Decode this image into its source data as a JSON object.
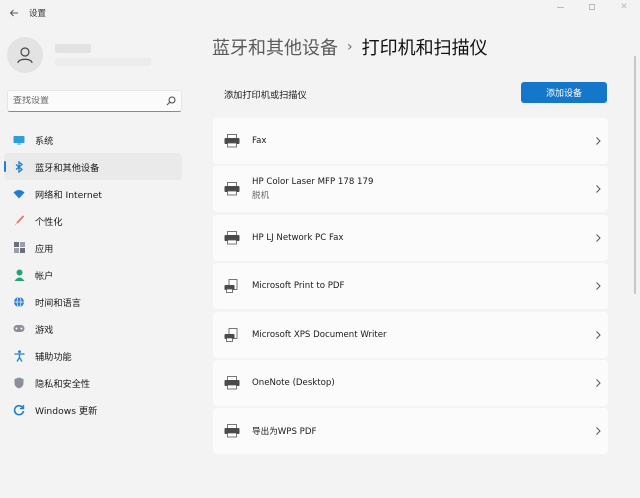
{
  "window": {
    "app_title": "设置",
    "back_icon": "back-arrow-icon"
  },
  "sidebar": {
    "search_placeholder": "查找设置",
    "items": [
      {
        "label": "系统",
        "icon": "monitor-icon",
        "color": "#2b9fd8",
        "active": false
      },
      {
        "label": "蓝牙和其他设备",
        "icon": "bluetooth-icon",
        "color": "#1f7fd0",
        "active": true
      },
      {
        "label": "网络和 Internet",
        "icon": "wifi-icon",
        "color": "#1f7fd0",
        "active": false
      },
      {
        "label": "个性化",
        "icon": "brush-icon",
        "color": "#d9826b",
        "active": false
      },
      {
        "label": "应用",
        "icon": "apps-icon",
        "color": "#6b6f78",
        "active": false
      },
      {
        "label": "帐户",
        "icon": "account-icon",
        "color": "#1fa37a",
        "active": false
      },
      {
        "label": "时间和语言",
        "icon": "globe-clock-icon",
        "color": "#2b7fd0",
        "active": false
      },
      {
        "label": "游戏",
        "icon": "gamepad-icon",
        "color": "#8b8f98",
        "active": false
      },
      {
        "label": "辅助功能",
        "icon": "accessibility-icon",
        "color": "#1f7fd0",
        "active": false
      },
      {
        "label": "隐私和安全性",
        "icon": "shield-icon",
        "color": "#8b8f98",
        "active": false
      },
      {
        "label": "Windows 更新",
        "icon": "windows-update-icon",
        "color": "#1f7fd0",
        "active": false
      }
    ]
  },
  "main": {
    "breadcrumb_parent": "蓝牙和其他设备",
    "breadcrumb_current": "打印机和扫描仪",
    "add_label": "添加打印机或扫描仪",
    "add_button": "添加设备",
    "accent": "#1577c9",
    "printers": [
      {
        "name": "Fax",
        "status": "",
        "icon": "fax-icon"
      },
      {
        "name": "HP Color Laser MFP 178 179",
        "status": "脱机",
        "icon": "printer-icon"
      },
      {
        "name": "HP LJ Network PC Fax",
        "status": "",
        "icon": "fax-icon"
      },
      {
        "name": "Microsoft Print to PDF",
        "status": "",
        "icon": "document-printer-icon"
      },
      {
        "name": "Microsoft XPS Document Writer",
        "status": "",
        "icon": "document-printer-icon"
      },
      {
        "name": "OneNote (Desktop)",
        "status": "",
        "icon": "printer-icon"
      },
      {
        "name": "导出为WPS PDF",
        "status": "",
        "icon": "printer-icon"
      }
    ]
  }
}
